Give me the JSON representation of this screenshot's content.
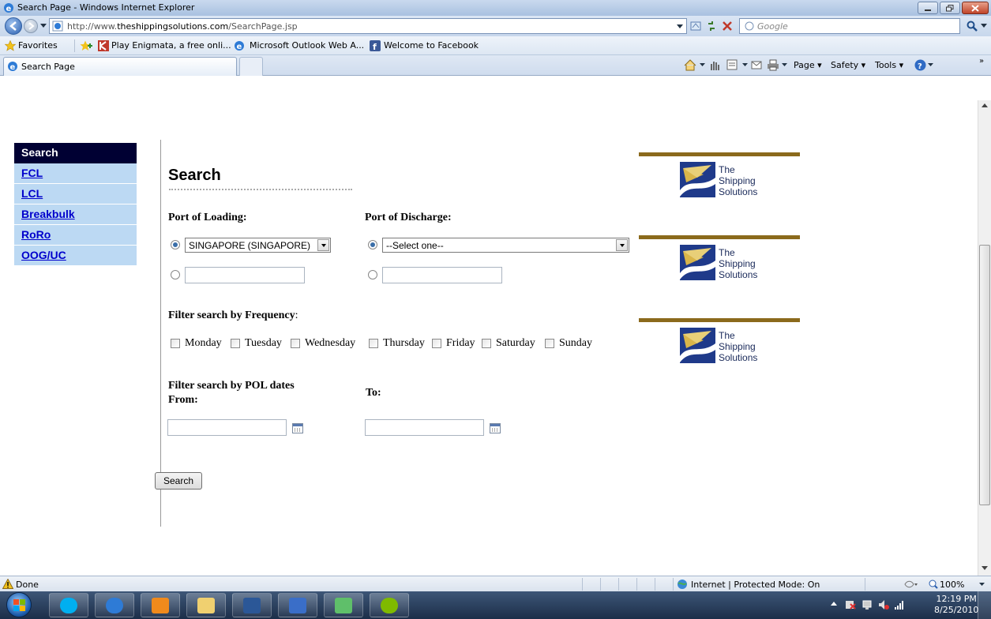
{
  "window": {
    "title": "Search Page - Windows Internet Explorer"
  },
  "address_bar": {
    "url_prefix": "http://www.",
    "url_domain": "theshippingsolutions.com",
    "url_path": "/SearchPage.jsp",
    "search_placeholder": "Google"
  },
  "favorites_bar": {
    "favorites_label": "Favorites",
    "items": [
      "Play Enigmata, a free onli...",
      "Microsoft Outlook Web A...",
      "Welcome to Facebook"
    ]
  },
  "tab": {
    "label": "Search Page"
  },
  "command_bar": {
    "page": "Page",
    "safety": "Safety",
    "tools": "Tools"
  },
  "side_nav": {
    "header": "Search",
    "items": [
      "FCL",
      "LCL",
      "Breakbulk",
      "RoRo",
      "OOG/UC"
    ]
  },
  "form": {
    "title": "Search",
    "port_of_loading_label": "Port of Loading:",
    "port_of_discharge_label": "Port of Discharge:",
    "port_of_loading_value": "SINGAPORE (SINGAPORE)",
    "port_of_discharge_value": "--Select one--",
    "frequency_label": "Filter search by Frequency",
    "frequency_colon": ":",
    "days": [
      "Monday",
      "Tuesday",
      "Wednesday",
      "Thursday",
      "Friday",
      "Saturday",
      "Sunday"
    ],
    "pol_dates_label_1": "Filter search by POL dates",
    "pol_dates_label_2": "From:",
    "to_label": "To:",
    "search_button": "Search"
  },
  "logo": {
    "line1": "The",
    "line2": "Shipping",
    "line3": "Solutions"
  },
  "status_bar": {
    "status": "Done",
    "zone": "Internet | Protected Mode: On",
    "zoom": "100%"
  },
  "taskbar": {
    "time": "12:19 PM",
    "date": "8/25/2010"
  },
  "colors": {
    "nav_header_bg": "#000033",
    "nav_item_bg": "#bcd9f3",
    "link": "#0000cc",
    "logo_bar": "#8b6a1c",
    "logo_navy": "#1a2a5a"
  }
}
